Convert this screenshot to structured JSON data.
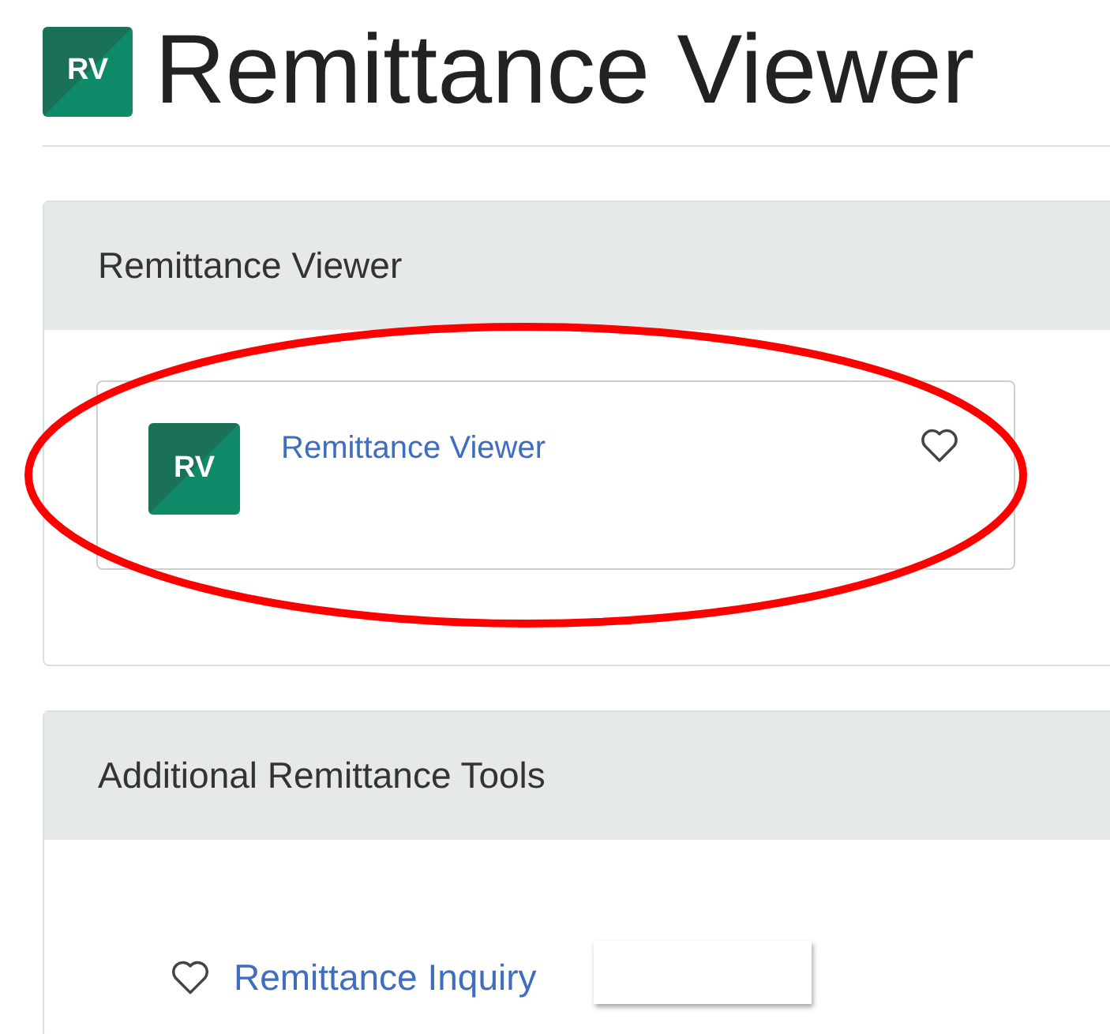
{
  "header": {
    "logo": "RV",
    "title": "Remittance Viewer"
  },
  "panels": [
    {
      "title": "Remittance Viewer",
      "kind": "cards",
      "items": [
        {
          "logo": "RV",
          "label": "Remittance Viewer",
          "favorite": false
        }
      ]
    },
    {
      "title": "Additional Remittance Tools",
      "kind": "links",
      "items": [
        {
          "label": "Remittance Inquiry",
          "favorite": false
        }
      ]
    }
  ]
}
